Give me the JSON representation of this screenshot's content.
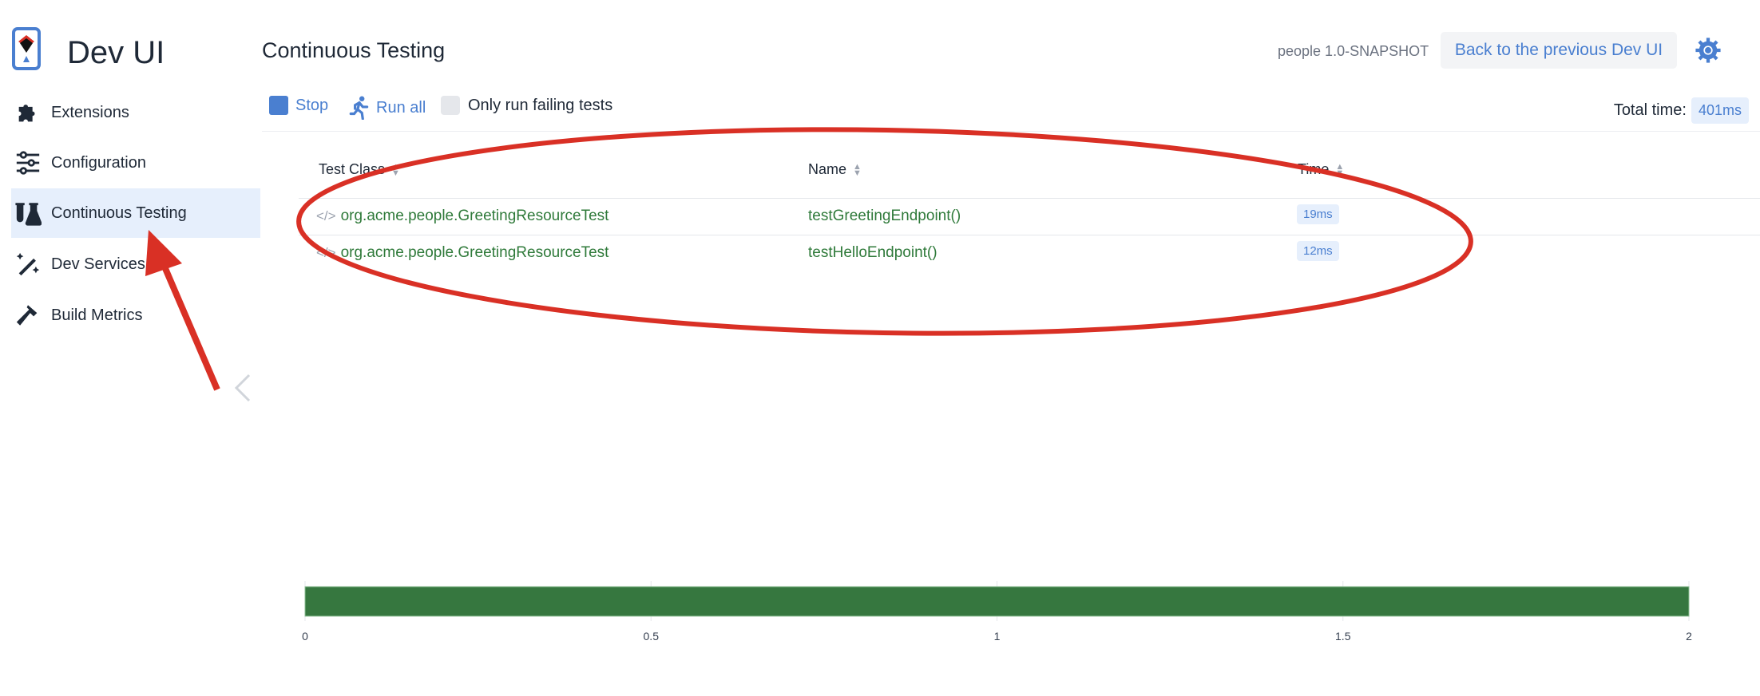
{
  "app": {
    "brand": "Dev UI",
    "version": "people 1.0-SNAPSHOT",
    "back_button": "Back to the previous Dev UI"
  },
  "sidebar": {
    "items": [
      {
        "label": "Extensions",
        "icon": "puzzle-icon"
      },
      {
        "label": "Configuration",
        "icon": "sliders-icon"
      },
      {
        "label": "Continuous Testing",
        "icon": "flask-icon",
        "active": true
      },
      {
        "label": "Dev Services",
        "icon": "magic-wand-icon"
      },
      {
        "label": "Build Metrics",
        "icon": "hammer-icon"
      }
    ]
  },
  "page": {
    "title": "Continuous Testing"
  },
  "toolbar": {
    "stop": "Stop",
    "run_all": "Run all",
    "only_failing": "Only run failing tests",
    "total_label": "Total time:",
    "total_value": "401ms"
  },
  "table": {
    "headers": [
      "Test Class",
      "Name",
      "Time"
    ],
    "rows": [
      {
        "class": "org.acme.people.GreetingResourceTest",
        "name": "testGreetingEndpoint()",
        "time": "19ms"
      },
      {
        "class": "org.acme.people.GreetingResourceTest",
        "name": "testHelloEndpoint()",
        "time": "12ms"
      }
    ]
  },
  "colors": {
    "accent": "#4a7fd0",
    "pass": "#2f7a3a",
    "bar": "#36773f",
    "annotation": "#d93025"
  },
  "chart_data": {
    "type": "bar",
    "orientation": "horizontal",
    "values": [
      2
    ],
    "xlim": [
      0,
      2
    ],
    "xticks": [
      "0",
      "0.5",
      "1",
      "1.5",
      "2"
    ],
    "grid": true,
    "color": "#36773f"
  }
}
